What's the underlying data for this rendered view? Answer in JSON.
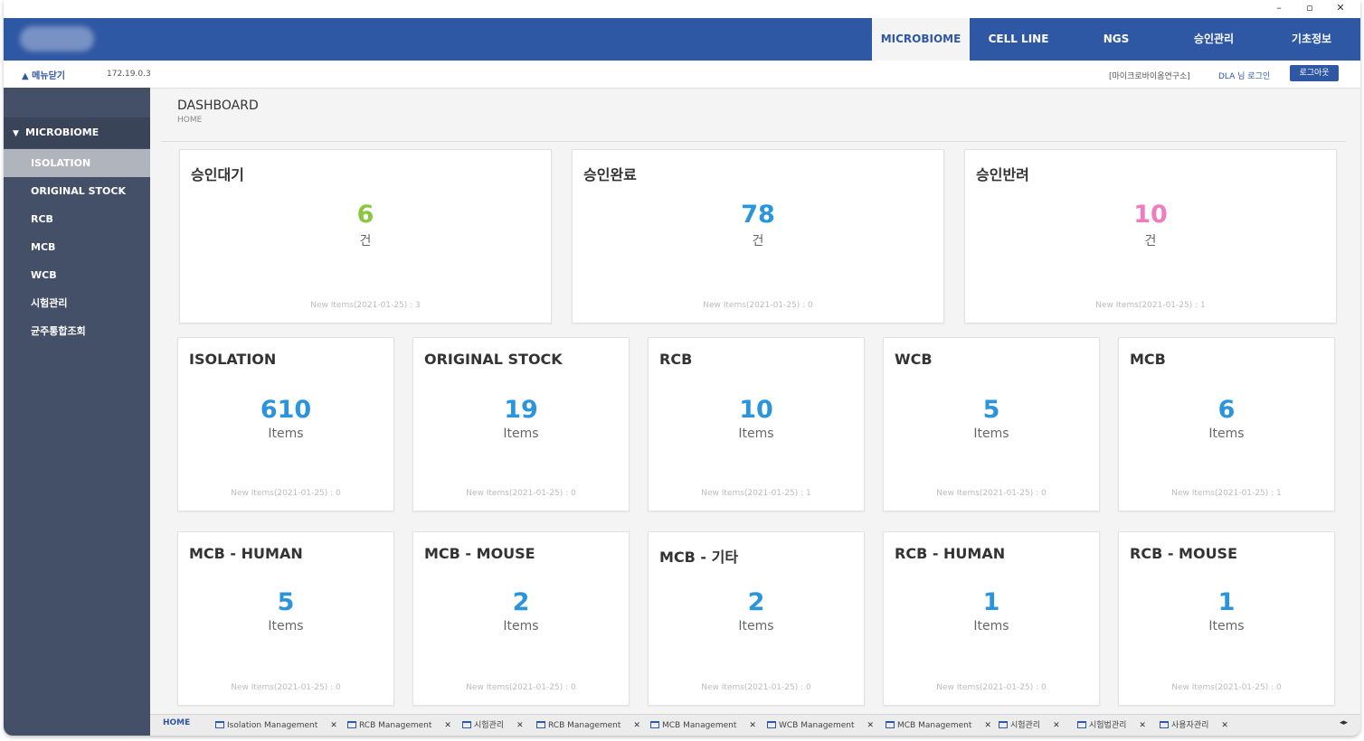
{
  "window": {
    "minimize": "–",
    "restore": "▫",
    "close": "✕"
  },
  "header": {
    "tabs": [
      {
        "label": "MICROBIOME",
        "active": true
      },
      {
        "label": "CELL LINE",
        "active": false
      },
      {
        "label": "NGS",
        "active": false
      },
      {
        "label": "승인관리",
        "active": false
      },
      {
        "label": "기초정보",
        "active": false
      }
    ]
  },
  "subbar": {
    "menu_close": "▲ 메뉴닫기",
    "ip": "172.19.0.3",
    "org": "[마이크로바이옴연구소]",
    "login_user": "DLA 님 로그인",
    "logout": "로그아웃"
  },
  "sidebar": {
    "group": "MICROBIOME",
    "items": [
      "ISOLATION",
      "ORIGINAL STOCK",
      "RCB",
      "MCB",
      "WCB",
      "시험관리",
      "균주통합조회"
    ],
    "active_index": 0
  },
  "page": {
    "title": "DASHBOARD",
    "breadcrumb": "HOME"
  },
  "approval_cards": [
    {
      "title": "승인대기",
      "value": "6",
      "unit": "건",
      "note": "New Items(2021-01-25) : 3",
      "color": "#8cc63f"
    },
    {
      "title": "승인완료",
      "value": "78",
      "unit": "건",
      "note": "New Items(2021-01-25) : 0",
      "color": "#2a94dc"
    },
    {
      "title": "승인반려",
      "value": "10",
      "unit": "건",
      "note": "New Items(2021-01-25) : 1",
      "color": "#f07cc0"
    }
  ],
  "stock_cards": [
    {
      "title": "ISOLATION",
      "value": "610",
      "unit": "Items",
      "note": "New Items(2021-01-25) : 0"
    },
    {
      "title": "ORIGINAL STOCK",
      "value": "19",
      "unit": "Items",
      "note": "New Items(2021-01-25) : 0"
    },
    {
      "title": "RCB",
      "value": "10",
      "unit": "Items",
      "note": "New Items(2021-01-25) : 1"
    },
    {
      "title": "WCB",
      "value": "5",
      "unit": "Items",
      "note": "New Items(2021-01-25) : 0"
    },
    {
      "title": "MCB",
      "value": "6",
      "unit": "Items",
      "note": "New Items(2021-01-25) : 1"
    }
  ],
  "species_cards": [
    {
      "title": "MCB - HUMAN",
      "value": "5",
      "unit": "Items",
      "note": "New Items(2021-01-25) : 0"
    },
    {
      "title": "MCB - MOUSE",
      "value": "2",
      "unit": "Items",
      "note": "New Items(2021-01-25) : 0"
    },
    {
      "title": "MCB - 기타",
      "value": "2",
      "unit": "Items",
      "note": "New Items(2021-01-25) : 0"
    },
    {
      "title": "RCB - HUMAN",
      "value": "1",
      "unit": "Items",
      "note": "New Items(2021-01-25) : 0"
    },
    {
      "title": "RCB - MOUSE",
      "value": "1",
      "unit": "Items",
      "note": "New Items(2021-01-25) : 0"
    }
  ],
  "value_color": "#2a94dc",
  "bottom_tabs": {
    "home": "HOME",
    "tabs": [
      "Isolation Management",
      "RCB Management",
      "시험관리",
      "RCB Management",
      "MCB Management",
      "WCB Management",
      "MCB Management",
      "시험관리",
      "시험법관리",
      "사용자관리"
    ],
    "close_glyph": "✕",
    "scroll": "◂▸"
  }
}
